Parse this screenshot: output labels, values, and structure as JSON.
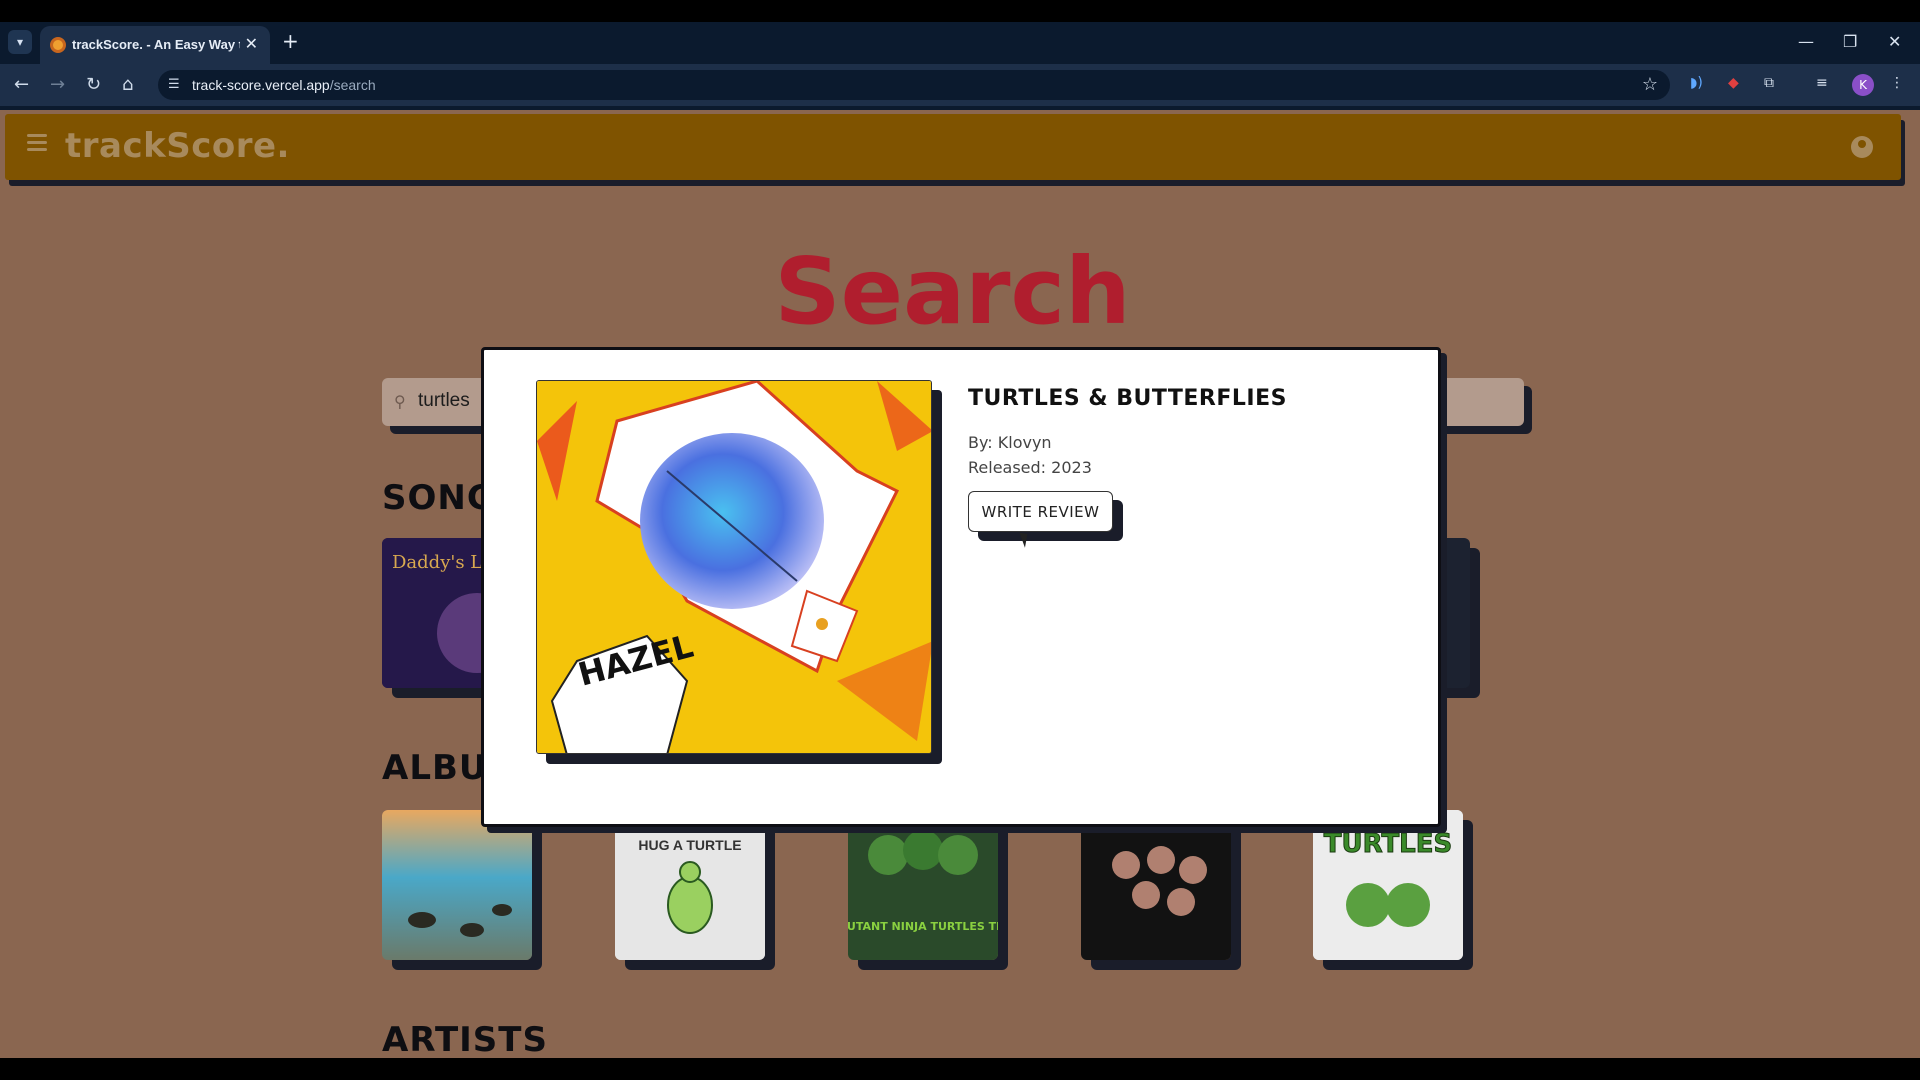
{
  "browser": {
    "tab_title": "trackScore. - An Easy Way to R",
    "url_host": "track-score.vercel.app",
    "url_path": "/search",
    "profile_initial": "K"
  },
  "app": {
    "brand": "trackScore.",
    "page_title": "Search",
    "search": {
      "value": "turtles"
    },
    "sections": {
      "songs": "SONGS",
      "albums": "ALBUMS",
      "artists": "ARTISTS"
    },
    "album_cards": [
      {
        "label": ""
      },
      {
        "label": "HUG A TURTLE"
      },
      {
        "label": "TEENAGE MUTANT NINJA TURTLES THEME SONG"
      },
      {
        "label": ""
      },
      {
        "label": "TURTLES"
      }
    ],
    "song_cards": [
      {
        "label": "Daddy's Lullaby"
      }
    ]
  },
  "modal": {
    "title": "TURTLES & BUTTERFLIES",
    "by": "By: Klovyn",
    "released": "Released: 2023",
    "button": "WRITE REVIEW",
    "cover_text": "HAZEL"
  },
  "colors": {
    "appbar": "#7f5300",
    "page_bg": "#8a6650",
    "title": "#b01e2e",
    "card_shadow": "#1a1d2a"
  }
}
